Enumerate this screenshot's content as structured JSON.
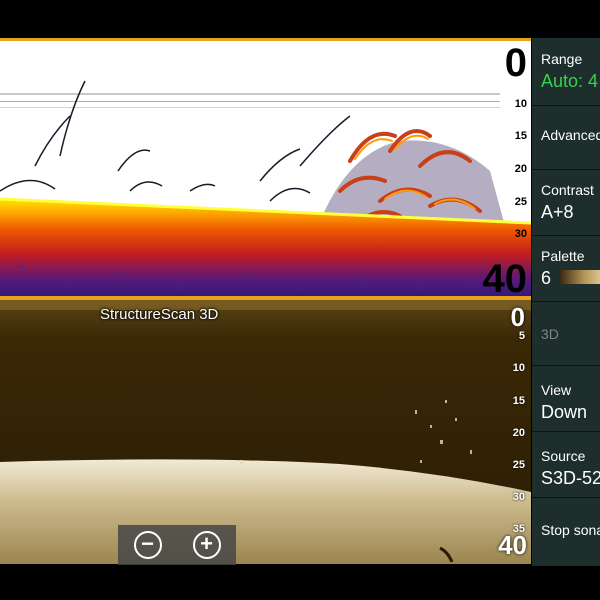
{
  "top_pane": {
    "depth_top": "0",
    "depth_bottom": "40",
    "ticks": [
      "10",
      "15",
      "20",
      "25",
      "30"
    ]
  },
  "bottom_pane": {
    "mode_label": "StructureScan 3D",
    "depth_top": "0",
    "depth_bottom": "40",
    "ticks": [
      "5",
      "10",
      "15",
      "20",
      "25",
      "30",
      "35"
    ]
  },
  "zoom": {
    "out_symbol": "−",
    "in_symbol": "+"
  },
  "menu": {
    "range_label": "Range",
    "range_value": "Auto: 4",
    "advanced_label": "Advanced",
    "contrast_label": "Contrast",
    "contrast_value": "A+8",
    "palette_label": "Palette",
    "palette_value": "6",
    "three_d_label": "3D",
    "view_label": "View",
    "view_value": "Down",
    "source_label": "Source",
    "source_value": "S3D-52",
    "stop_label": "Stop sonar"
  },
  "colors": {
    "accent": "#e6a21e",
    "menu_bg": "#1d2e2c",
    "value_green": "#35d34a"
  }
}
